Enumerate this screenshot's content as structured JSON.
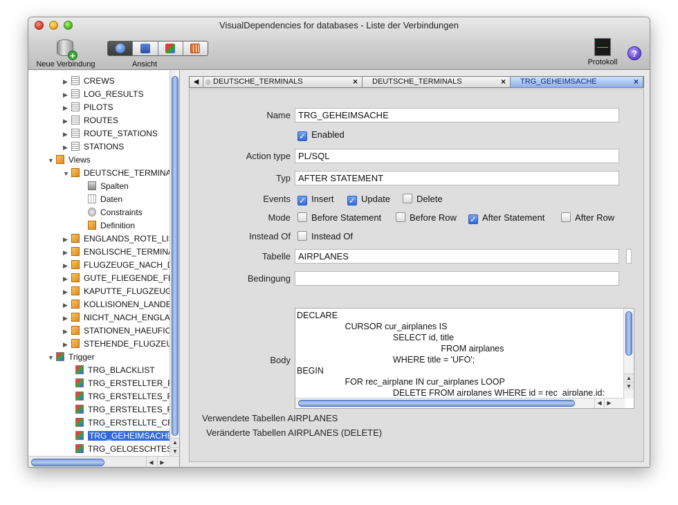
{
  "window": {
    "title": "VisualDependencies for databases - Liste der Verbindungen"
  },
  "toolbar": {
    "new_connection_label": "Neue Verbindung",
    "view_label": "Ansicht",
    "protokoll_label": "Protokoll",
    "help_glyph": "?"
  },
  "tree": {
    "items": [
      {
        "label": "CREWS",
        "icon": "table-icon"
      },
      {
        "label": "LOG_RESULTS",
        "icon": "table-icon"
      },
      {
        "label": "PILOTS",
        "icon": "table-icon"
      },
      {
        "label": "ROUTES",
        "icon": "table-icon"
      },
      {
        "label": "ROUTE_STATIONS",
        "icon": "table-icon"
      },
      {
        "label": "STATIONS",
        "icon": "table-icon"
      },
      {
        "label": "Views",
        "icon": "view-icon"
      },
      {
        "label": "DEUTSCHE_TERMINA",
        "icon": "view-icon"
      },
      {
        "label": "Spalten",
        "icon": "columns-icon"
      },
      {
        "label": "Daten",
        "icon": "data-icon"
      },
      {
        "label": "Constraints",
        "icon": "constraints-icon"
      },
      {
        "label": "Definition",
        "icon": "definition-icon"
      },
      {
        "label": "ENGLANDS_ROTE_LIS",
        "icon": "view-icon"
      },
      {
        "label": "ENGLISCHE_TERMINA",
        "icon": "view-icon"
      },
      {
        "label": "FLUGZEUGE_NACH_D",
        "icon": "view-icon"
      },
      {
        "label": "GUTE_FLIEGENDE_FL",
        "icon": "view-icon"
      },
      {
        "label": "KAPUTTE_FLUGZEUG",
        "icon": "view-icon"
      },
      {
        "label": "KOLLISIONEN_LANDE",
        "icon": "view-icon"
      },
      {
        "label": "NICHT_NACH_ENGLA",
        "icon": "view-icon"
      },
      {
        "label": "STATIONEN_HAEUFIC",
        "icon": "view-icon"
      },
      {
        "label": "STEHENDE_FLUGZEU",
        "icon": "view-icon"
      },
      {
        "label": "Trigger",
        "icon": "trigger-icon"
      },
      {
        "label": "TRG_BLACKLIST",
        "icon": "trigger-icon"
      },
      {
        "label": "TRG_ERSTELLTER_PII",
        "icon": "trigger-icon"
      },
      {
        "label": "TRG_ERSTELLTES_FLI",
        "icon": "trigger-icon"
      },
      {
        "label": "TRG_ERSTELLTES_FLI",
        "icon": "trigger-icon"
      },
      {
        "label": "TRG_ERSTELLTE_CRE",
        "icon": "trigger-icon"
      },
      {
        "label": "TRG_GEHEIMSACHE",
        "icon": "trigger-icon"
      },
      {
        "label": "TRG_GELOESCHTES_",
        "icon": "trigger-icon"
      }
    ]
  },
  "tabs": [
    {
      "label": "DEUTSCHE_TERMINALS"
    },
    {
      "label": "DEUTSCHE_TERMINALS"
    },
    {
      "label": "TRG_GEHEIMSACHE"
    }
  ],
  "form": {
    "name_label": "Name",
    "name_value": "TRG_GEHEIMSACHE",
    "enabled_label": "Enabled",
    "action_type_label": "Action type",
    "action_type_value": "PL/SQL",
    "typ_label": "Typ",
    "typ_value": "AFTER STATEMENT",
    "events_label": "Events",
    "event_insert": "Insert",
    "event_update": "Update",
    "event_delete": "Delete",
    "mode_label": "Mode",
    "mode_before_statement": "Before Statement",
    "mode_before_row": "Before Row",
    "mode_after_statement": "After Statement",
    "mode_after_row": "After Row",
    "instead_of_label": "Instead Of",
    "instead_of_checkbox": "Instead Of",
    "tabelle_label": "Tabelle",
    "tabelle_value": "AIRPLANES",
    "bedingung_label": "Bedingung",
    "bedingung_value": "",
    "body_label": "Body",
    "body_code": "DECLARE\n                    CURSOR cur_airplanes IS\n                                        SELECT id, title\n                                                            FROM airplanes\n                                        WHERE title = 'UFO';\nBEGIN\n                    FOR rec_airplane IN cur_airplanes LOOP\n                                        DELETE FROM airplanes WHERE id = rec_airplane.id;",
    "used_tables": "Verwendete Tabellen AIRPLANES",
    "changed_tables": "Veränderte Tabellen AIRPLANES (DELETE)"
  },
  "checkmark": "✓"
}
